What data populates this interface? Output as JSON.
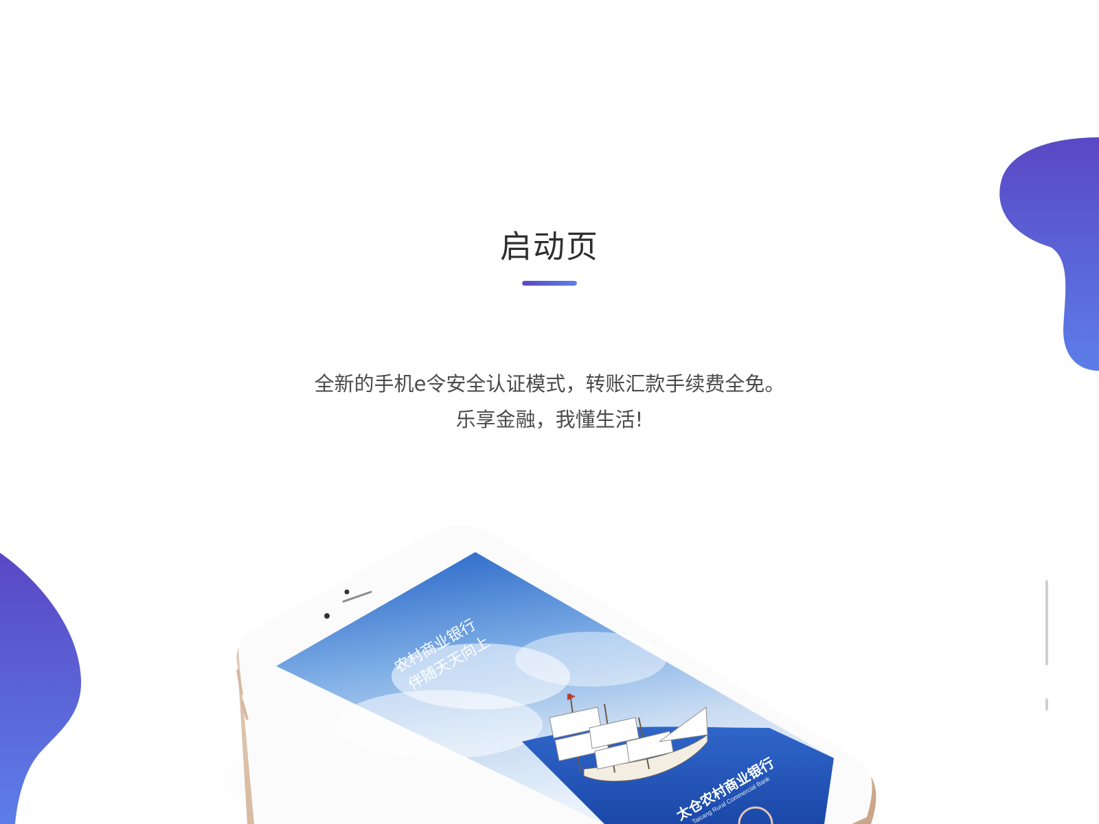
{
  "header": {
    "title": "启动页"
  },
  "description": {
    "line1": "全新的手机e令安全认证模式，转账汇款手续费全免。",
    "line2": "乐享金融，我懂生活!"
  },
  "phone": {
    "slogan_line1": "农村商业银行",
    "slogan_line2": "伴随天天向上",
    "bank_name": "太仓农村商业银行",
    "bank_name_en": "Taicang Rural Commercial Bank"
  },
  "colors": {
    "accent_start": "#5a48c4",
    "accent_end": "#5c7ee8",
    "title": "#2e2e2e",
    "text": "#4a4a4a"
  },
  "icons": {
    "decor_top_right": "blob-shape",
    "decor_bottom_left": "blob-shape",
    "phone": "smartphone-mockup"
  }
}
